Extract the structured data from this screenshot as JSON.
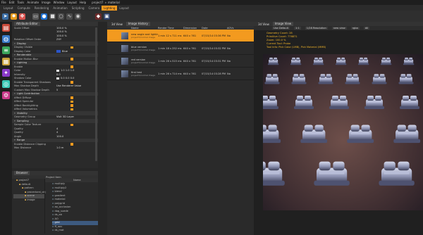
{
  "menu": [
    "File",
    "Edit",
    "Tools",
    "Animate",
    "Image",
    "Window",
    "Layout",
    "Help"
  ],
  "project": {
    "name": "project7",
    "sep": "»",
    "scene": "material",
    "bullet": "»"
  },
  "tabs": [
    "Layout",
    "Compute",
    "Rendering",
    "Animation",
    "Scripting",
    "Camera",
    "Lighting",
    "Layout"
  ],
  "active_tab_index": 6,
  "attribute_editor": {
    "tab": "Attribute Editor",
    "rows": [
      {
        "label": "Scale Offset",
        "value": "100.0 %",
        "type": "value"
      },
      {
        "label": "",
        "value": "100.0 %",
        "type": "value"
      },
      {
        "label": "",
        "value": "100.0 %",
        "type": "value"
      },
      {
        "label": "Rotation Offset Order",
        "value": "ZXY",
        "type": "value"
      },
      {
        "label": "Display",
        "type": "section"
      },
      {
        "label": "Display Visible",
        "type": "check"
      },
      {
        "label": "Display Color",
        "value": "Blue",
        "type": "color"
      },
      {
        "label": "Renderable",
        "type": "section"
      },
      {
        "label": "Enable Motion Blur",
        "type": "check"
      },
      {
        "label": "Lighting",
        "type": "section"
      },
      {
        "label": "Enable",
        "type": "check"
      },
      {
        "label": "Color",
        "value": "1.0   1.0   1.0",
        "type": "rgb"
      },
      {
        "label": "Intensity",
        "value": "0.0",
        "type": "value"
      },
      {
        "label": "Shadow Color",
        "value": "0.0   0.0   0.0",
        "type": "rgb"
      },
      {
        "label": "Enable Transparent Shadows",
        "type": "check"
      },
      {
        "label": "Max Shadow Depth",
        "value": "Use Renderer Value",
        "type": "value"
      },
      {
        "label": "Custom Max Shadow Depth",
        "value": "5",
        "type": "value"
      },
      {
        "label": "Light Contribution",
        "type": "section"
      },
      {
        "label": "Affect Diffuse",
        "type": "check"
      },
      {
        "label": "Affect Specular",
        "type": "check"
      },
      {
        "label": "Affect Backlighting",
        "type": "check"
      },
      {
        "label": "Affect Volumetrics",
        "type": "check"
      },
      {
        "label": "Visibility",
        "type": "section"
      },
      {
        "label": "Geometry Group",
        "value": "Visit 3D Layer",
        "type": "value"
      },
      {
        "label": "Sampling",
        "type": "section"
      },
      {
        "label": "Sample Color Texture",
        "type": "check"
      },
      {
        "label": "Quality",
        "value": "4",
        "type": "value"
      },
      {
        "label": "Quality",
        "value": "4",
        "type": "value"
      },
      {
        "label": "Angle",
        "value": "100.0",
        "type": "value"
      },
      {
        "label": "Range",
        "type": "section"
      },
      {
        "label": "Enable Distance Clipping",
        "type": "check"
      },
      {
        "label": "Max Distance",
        "value": "1.0 m",
        "type": "value"
      }
    ]
  },
  "image_history": {
    "tabs": [
      "3d View",
      "Image History"
    ],
    "columns": [
      "Name",
      "Render Time",
      "Dimension",
      "Date",
      "AOVs"
    ],
    "rows": [
      {
        "name": "new angle and lighting",
        "sub": "project7/normal image",
        "time": "1 min 12 s 711 ms",
        "dim": "640 x 761",
        "date": "07/15/14  03:36 PM",
        "aovs": "No",
        "selected": true
      },
      {
        "name": "blue version",
        "sub": "project7/normal image",
        "time": "1 min 18 s 252 ms",
        "dim": "640 x 761",
        "date": "07/15/14  03:32 PM",
        "aovs": "No",
        "selected": false
      },
      {
        "name": "red version",
        "sub": "project7/normal image",
        "time": "1 min 26 s 515 ms",
        "dim": "640 x 761",
        "date": "07/15/14  03:31 PM",
        "aovs": "No",
        "selected": false
      },
      {
        "name": "first test",
        "sub": "project7/normal image",
        "time": "1 min 26 s 714 ms",
        "dim": "640 x 761",
        "date": "07/15/14  03:28 PM",
        "aovs": "No",
        "selected": false
      }
    ]
  },
  "image_view": {
    "tabs": [
      "3d View",
      "Image View"
    ],
    "toolbar": [
      "Use Default",
      "1:1",
      "1/28 Resolution",
      "new view",
      "rgba",
      "All"
    ],
    "info": [
      "Geometry Count: 28",
      "Primitive Count: 776871",
      "Zoom: 100.0 %",
      "Current Tool: Probe",
      "Tool Info: Pick Color (LMB), Pick Material (MMB)"
    ],
    "info_color": "#f0b429"
  },
  "browser": {
    "tab": "Browser",
    "path": "Project Item",
    "name_col": "Name",
    "tree": [
      "project7",
      "default",
      "pattern",
      "procedural_obj",
      "scene",
      "image"
    ],
    "files": [
      "multiply",
      "multiply2",
      "blend",
      "gradient",
      "material",
      "polygrid",
      "ao_occlusion",
      "dog_suede",
      "ds_ab",
      "AO",
      "grid",
      "ff_aov",
      "ds_mat"
    ],
    "selected_file": 10
  },
  "colors": {
    "accent": "#f39a1f",
    "panel": "#2a2a2a",
    "info": "#f0b429"
  }
}
